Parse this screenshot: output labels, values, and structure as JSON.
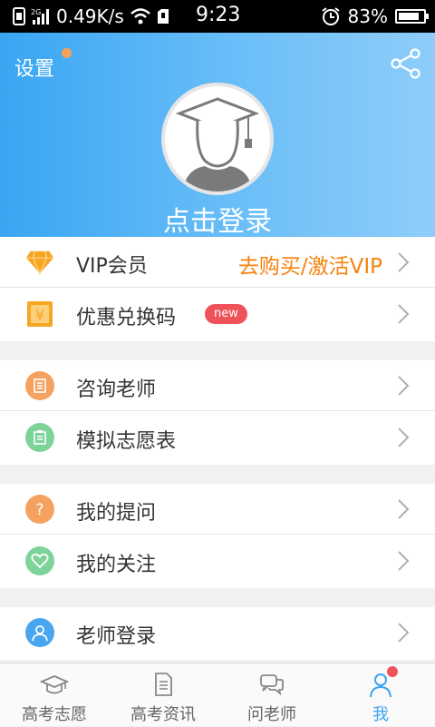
{
  "status_bar": {
    "network": "2G",
    "speed": "0.49K/s",
    "time": "9:23",
    "battery": "83%",
    "battery_level": 0.83
  },
  "header": {
    "settings_label": "设置",
    "login_prompt": "点击登录"
  },
  "menu_groups": [
    [
      {
        "label": "VIP会员",
        "action": "去购买/激活VIP",
        "icon": "diamond-icon"
      },
      {
        "label": "优惠兑换码",
        "badge": "new",
        "icon": "coupon-icon"
      }
    ],
    [
      {
        "label": "咨询老师",
        "icon": "consult-icon"
      },
      {
        "label": "模拟志愿表",
        "icon": "form-icon"
      }
    ],
    [
      {
        "label": "我的提问",
        "icon": "question-icon"
      },
      {
        "label": "我的关注",
        "icon": "heart-icon"
      }
    ],
    [
      {
        "label": "老师登录",
        "icon": "teacher-icon"
      }
    ]
  ],
  "tabs": [
    {
      "label": "高考志愿",
      "icon": "graduation-cap-icon",
      "active": false
    },
    {
      "label": "高考资讯",
      "icon": "news-icon",
      "active": false
    },
    {
      "label": "问老师",
      "icon": "chat-icon",
      "active": false
    },
    {
      "label": "我",
      "icon": "person-icon",
      "active": true
    }
  ],
  "colors": {
    "header_blue": "#39a6f3",
    "accent_orange": "#f7820e",
    "badge_red": "#f0525a",
    "tab_active": "#3aa3f0"
  }
}
